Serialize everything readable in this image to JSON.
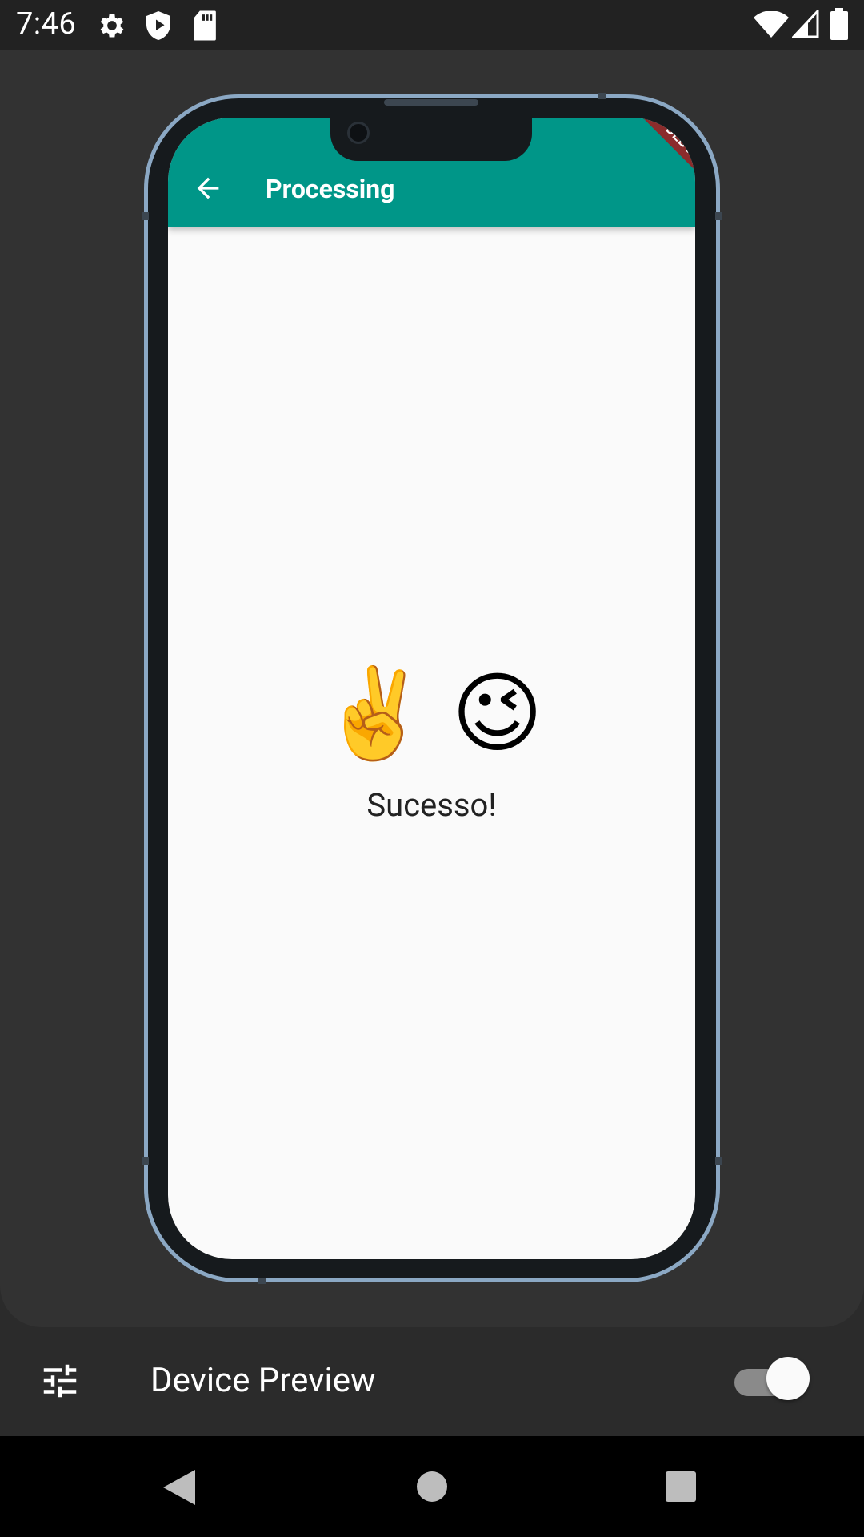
{
  "status_bar": {
    "time": "7:46",
    "icons": [
      "gear-icon",
      "shield-play-icon",
      "sd-card-icon",
      "wifi-icon",
      "signal-icon",
      "battery-icon"
    ]
  },
  "app": {
    "title": "Processing",
    "back_icon": "arrow-back-icon",
    "debug_banner": "DEBUG",
    "accent_color": "#009688",
    "emojis": [
      "✌️",
      "😉"
    ],
    "message": "Sucesso!"
  },
  "device_preview_bar": {
    "label": "Device Preview",
    "settings_icon": "tune-sliders-icon",
    "toggle_on": true
  },
  "nav_bar": {
    "buttons": [
      "back-triangle-icon",
      "home-circle-icon",
      "recents-square-icon"
    ]
  }
}
